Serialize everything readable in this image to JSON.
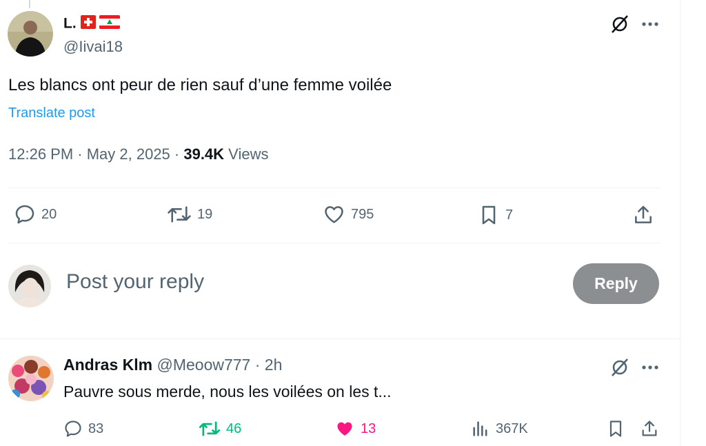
{
  "post": {
    "author_name": "L.",
    "author_handle": "@Iivai18",
    "text": "Les blancs ont peur de rien sauf d’une femme voilée",
    "translate_label": "Translate post",
    "time": "12:26 PM · May 2, 2025 · ",
    "views_count": "39.4K",
    "views_label": " Views",
    "stats": {
      "replies": "20",
      "reposts": "19",
      "likes": "795",
      "bookmarks": "7"
    }
  },
  "composer": {
    "placeholder": "Post your reply",
    "button_label": "Reply"
  },
  "reply": {
    "author_name": "Andras Klm",
    "author_handle": "@Meoow777",
    "age": " · 2h",
    "text": "Pauvre sous merde, nous les voilées on les t...",
    "stats": {
      "replies": "83",
      "reposts": "46",
      "likes": "13",
      "views": "367K"
    }
  },
  "colors": {
    "repost_active": "#00ba7c",
    "like_active": "#f91880",
    "link": "#1d9bf0",
    "muted": "#536471"
  },
  "icons": [
    "grok-icon",
    "more-icon",
    "reply-icon",
    "repost-icon",
    "like-icon",
    "bookmark-icon",
    "share-icon",
    "views-icon",
    "swiss-flag-icon",
    "lebanon-flag-icon"
  ]
}
